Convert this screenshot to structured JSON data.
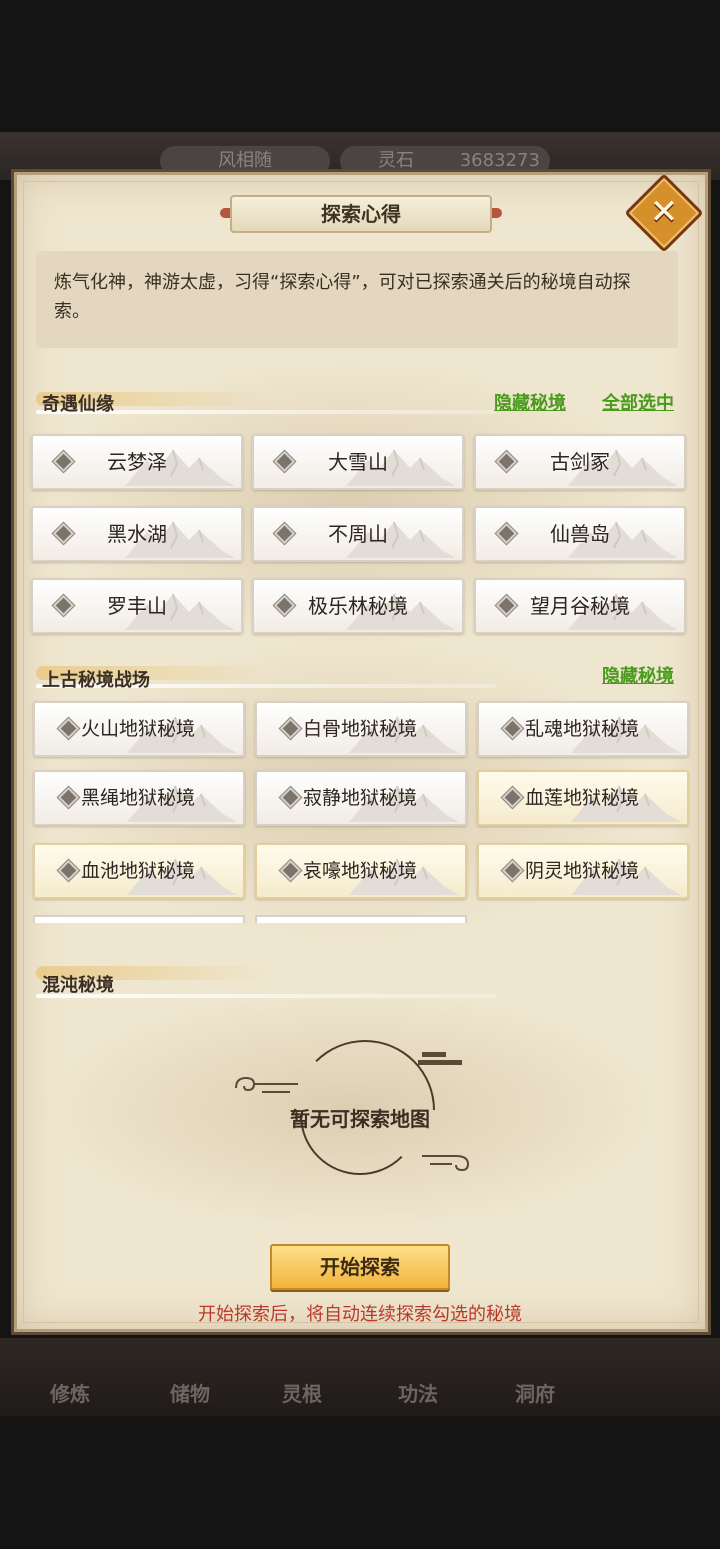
{
  "background": {
    "top_pills": [
      "风相随",
      "灵石",
      "3683273"
    ],
    "bottom_tabs": [
      "修炼",
      "储物",
      "灵根",
      "功法",
      "洞府"
    ]
  },
  "dialog": {
    "title": "探索心得",
    "close_icon": "close-icon",
    "description": "炼气化神，神游太虚，习得“探索心得”，可对已探索通关后的秘境自动探索。"
  },
  "section1": {
    "label": "奇遇仙缘",
    "hide_link": "隐藏秘境",
    "select_all_link": "全部选中",
    "items": [
      {
        "label": "云梦泽",
        "selected": false
      },
      {
        "label": "大雪山",
        "selected": false
      },
      {
        "label": "古剑冢",
        "selected": false
      },
      {
        "label": "黑水湖",
        "selected": false
      },
      {
        "label": "不周山",
        "selected": false
      },
      {
        "label": "仙兽岛",
        "selected": false
      },
      {
        "label": "罗丰山",
        "selected": false
      },
      {
        "label": "极乐林秘境",
        "selected": false
      },
      {
        "label": "望月谷秘境",
        "selected": false
      }
    ]
  },
  "section2": {
    "label": "上古秘境战场",
    "hide_link": "隐藏秘境",
    "items": [
      {
        "label": "火山地狱秘境",
        "selected": false
      },
      {
        "label": "白骨地狱秘境",
        "selected": false
      },
      {
        "label": "乱魂地狱秘境",
        "selected": false
      },
      {
        "label": "黑绳地狱秘境",
        "selected": false
      },
      {
        "label": "寂静地狱秘境",
        "selected": false
      },
      {
        "label": "血莲地狱秘境",
        "selected": true
      },
      {
        "label": "血池地狱秘境",
        "selected": true
      },
      {
        "label": "哀嚎地狱秘境",
        "selected": true
      },
      {
        "label": "阴灵地狱秘境",
        "selected": true
      }
    ]
  },
  "section3": {
    "label": "混沌秘境",
    "empty_text": "暂无可探索地图"
  },
  "footer": {
    "start_button": "开始探索",
    "hint": "开始探索后，将自动连续探索勾选的秘境"
  }
}
